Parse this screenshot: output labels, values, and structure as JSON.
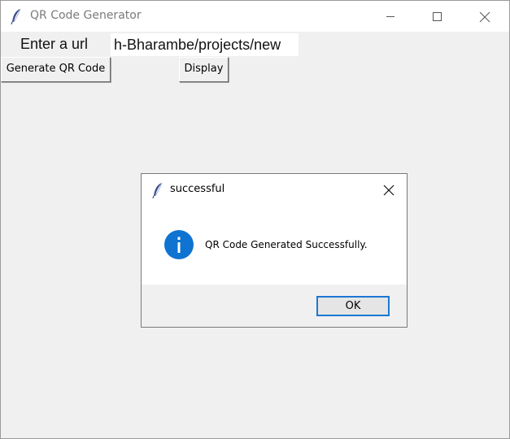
{
  "window": {
    "title": "QR Code Generator",
    "icons": {
      "app": "feather-icon",
      "minimize": "minimize-icon",
      "maximize": "maximize-icon",
      "close": "close-icon"
    }
  },
  "form": {
    "url_label": "Enter a url",
    "url_value": "h-Bharambe/projects/new",
    "generate_label": "Generate QR Code",
    "display_label": "Display"
  },
  "dialog": {
    "title": "successful",
    "message": "QR Code Generated Successfully.",
    "ok_label": "OK",
    "icons": {
      "title": "feather-icon",
      "close": "close-icon",
      "info": "info-icon"
    },
    "accent_color": "#1a78d4",
    "info_color": "#0e73d1"
  }
}
